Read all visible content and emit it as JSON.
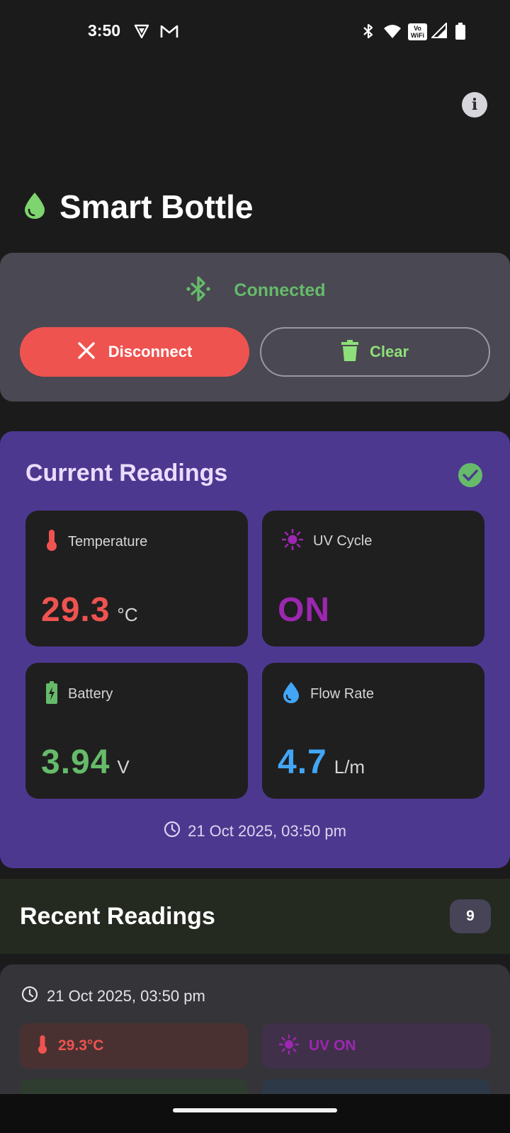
{
  "status_bar": {
    "time": "3:50",
    "icons": [
      "vpn-icon",
      "gmail-icon",
      "bluetooth-icon",
      "wifi-icon",
      "vowifi-icon",
      "signal-icon",
      "battery-icon"
    ],
    "vowifi_text_top": "Vo",
    "vowifi_text_bottom": "WiFi"
  },
  "header": {
    "info_glyph": "i",
    "app_icon": "water-drop-icon",
    "title": "Smart Bottle"
  },
  "connection": {
    "status": "Connected",
    "status_icon": "bluetooth-searching-icon",
    "disconnect_label": "Disconnect",
    "clear_label": "Clear"
  },
  "current": {
    "title": "Current Readings",
    "tiles": [
      {
        "label": "Temperature",
        "icon": "thermometer-icon",
        "value": "29.3",
        "unit": "°C",
        "color": "#ef5350"
      },
      {
        "label": "UV Cycle",
        "icon": "sun-icon",
        "value": "ON",
        "unit": "",
        "color": "#9c27b0"
      },
      {
        "label": "Battery",
        "icon": "battery-charging-icon",
        "value": "3.94",
        "unit": "V",
        "color": "#66bb6a"
      },
      {
        "label": "Flow Rate",
        "icon": "water-drop-icon",
        "value": "4.7",
        "unit": "L/m",
        "color": "#42a5f5"
      }
    ],
    "timestamp": "21 Oct 2025, 03:50 pm"
  },
  "recent": {
    "title": "Recent Readings",
    "count": "9",
    "items": [
      {
        "timestamp": "21 Oct 2025, 03:50 pm",
        "temperature": "29.3°C",
        "uv": "UV ON"
      }
    ]
  },
  "colors": {
    "background": "#1b1b1b",
    "connected_green": "#66bb6a",
    "disconnect_red": "#ef5350",
    "clear_green": "#8ee07a",
    "current_card_purple": "#4d3890",
    "temperature_red": "#ef5350",
    "uv_purple": "#9c27b0",
    "battery_green": "#66bb6a",
    "flow_blue": "#42a5f5"
  }
}
